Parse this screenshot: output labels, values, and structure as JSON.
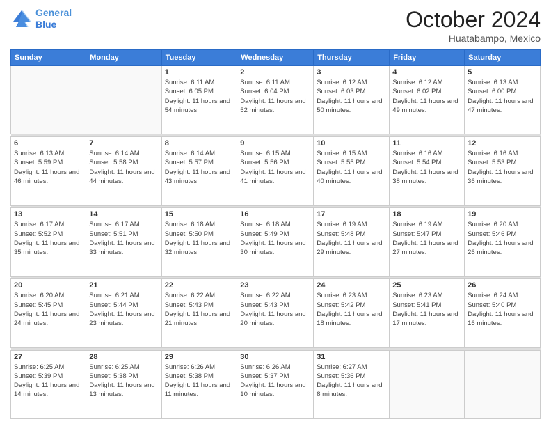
{
  "header": {
    "logo_line1": "General",
    "logo_line2": "Blue",
    "month": "October 2024",
    "location": "Huatabampo, Mexico"
  },
  "days_of_week": [
    "Sunday",
    "Monday",
    "Tuesday",
    "Wednesday",
    "Thursday",
    "Friday",
    "Saturday"
  ],
  "weeks": [
    [
      {
        "day": "",
        "info": ""
      },
      {
        "day": "",
        "info": ""
      },
      {
        "day": "1",
        "info": "Sunrise: 6:11 AM\nSunset: 6:05 PM\nDaylight: 11 hours and 54 minutes."
      },
      {
        "day": "2",
        "info": "Sunrise: 6:11 AM\nSunset: 6:04 PM\nDaylight: 11 hours and 52 minutes."
      },
      {
        "day": "3",
        "info": "Sunrise: 6:12 AM\nSunset: 6:03 PM\nDaylight: 11 hours and 50 minutes."
      },
      {
        "day": "4",
        "info": "Sunrise: 6:12 AM\nSunset: 6:02 PM\nDaylight: 11 hours and 49 minutes."
      },
      {
        "day": "5",
        "info": "Sunrise: 6:13 AM\nSunset: 6:00 PM\nDaylight: 11 hours and 47 minutes."
      }
    ],
    [
      {
        "day": "6",
        "info": "Sunrise: 6:13 AM\nSunset: 5:59 PM\nDaylight: 11 hours and 46 minutes."
      },
      {
        "day": "7",
        "info": "Sunrise: 6:14 AM\nSunset: 5:58 PM\nDaylight: 11 hours and 44 minutes."
      },
      {
        "day": "8",
        "info": "Sunrise: 6:14 AM\nSunset: 5:57 PM\nDaylight: 11 hours and 43 minutes."
      },
      {
        "day": "9",
        "info": "Sunrise: 6:15 AM\nSunset: 5:56 PM\nDaylight: 11 hours and 41 minutes."
      },
      {
        "day": "10",
        "info": "Sunrise: 6:15 AM\nSunset: 5:55 PM\nDaylight: 11 hours and 40 minutes."
      },
      {
        "day": "11",
        "info": "Sunrise: 6:16 AM\nSunset: 5:54 PM\nDaylight: 11 hours and 38 minutes."
      },
      {
        "day": "12",
        "info": "Sunrise: 6:16 AM\nSunset: 5:53 PM\nDaylight: 11 hours and 36 minutes."
      }
    ],
    [
      {
        "day": "13",
        "info": "Sunrise: 6:17 AM\nSunset: 5:52 PM\nDaylight: 11 hours and 35 minutes."
      },
      {
        "day": "14",
        "info": "Sunrise: 6:17 AM\nSunset: 5:51 PM\nDaylight: 11 hours and 33 minutes."
      },
      {
        "day": "15",
        "info": "Sunrise: 6:18 AM\nSunset: 5:50 PM\nDaylight: 11 hours and 32 minutes."
      },
      {
        "day": "16",
        "info": "Sunrise: 6:18 AM\nSunset: 5:49 PM\nDaylight: 11 hours and 30 minutes."
      },
      {
        "day": "17",
        "info": "Sunrise: 6:19 AM\nSunset: 5:48 PM\nDaylight: 11 hours and 29 minutes."
      },
      {
        "day": "18",
        "info": "Sunrise: 6:19 AM\nSunset: 5:47 PM\nDaylight: 11 hours and 27 minutes."
      },
      {
        "day": "19",
        "info": "Sunrise: 6:20 AM\nSunset: 5:46 PM\nDaylight: 11 hours and 26 minutes."
      }
    ],
    [
      {
        "day": "20",
        "info": "Sunrise: 6:20 AM\nSunset: 5:45 PM\nDaylight: 11 hours and 24 minutes."
      },
      {
        "day": "21",
        "info": "Sunrise: 6:21 AM\nSunset: 5:44 PM\nDaylight: 11 hours and 23 minutes."
      },
      {
        "day": "22",
        "info": "Sunrise: 6:22 AM\nSunset: 5:43 PM\nDaylight: 11 hours and 21 minutes."
      },
      {
        "day": "23",
        "info": "Sunrise: 6:22 AM\nSunset: 5:43 PM\nDaylight: 11 hours and 20 minutes."
      },
      {
        "day": "24",
        "info": "Sunrise: 6:23 AM\nSunset: 5:42 PM\nDaylight: 11 hours and 18 minutes."
      },
      {
        "day": "25",
        "info": "Sunrise: 6:23 AM\nSunset: 5:41 PM\nDaylight: 11 hours and 17 minutes."
      },
      {
        "day": "26",
        "info": "Sunrise: 6:24 AM\nSunset: 5:40 PM\nDaylight: 11 hours and 16 minutes."
      }
    ],
    [
      {
        "day": "27",
        "info": "Sunrise: 6:25 AM\nSunset: 5:39 PM\nDaylight: 11 hours and 14 minutes."
      },
      {
        "day": "28",
        "info": "Sunrise: 6:25 AM\nSunset: 5:38 PM\nDaylight: 11 hours and 13 minutes."
      },
      {
        "day": "29",
        "info": "Sunrise: 6:26 AM\nSunset: 5:38 PM\nDaylight: 11 hours and 11 minutes."
      },
      {
        "day": "30",
        "info": "Sunrise: 6:26 AM\nSunset: 5:37 PM\nDaylight: 11 hours and 10 minutes."
      },
      {
        "day": "31",
        "info": "Sunrise: 6:27 AM\nSunset: 5:36 PM\nDaylight: 11 hours and 8 minutes."
      },
      {
        "day": "",
        "info": ""
      },
      {
        "day": "",
        "info": ""
      }
    ]
  ]
}
